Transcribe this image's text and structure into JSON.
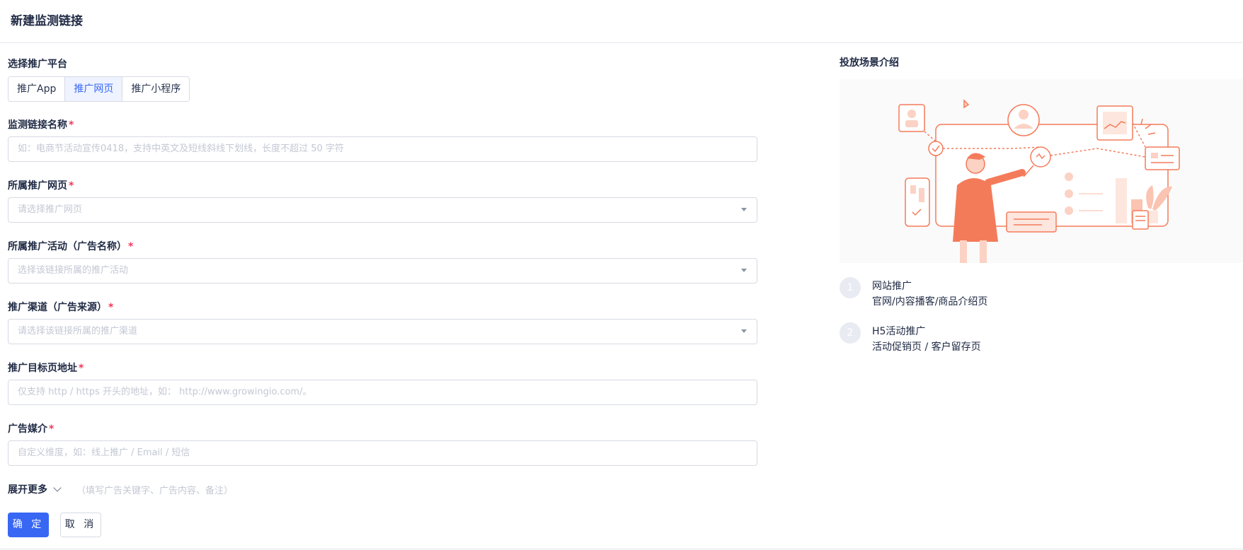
{
  "header": {
    "title": "新建监测链接"
  },
  "platform": {
    "label": "选择推广平台",
    "options": [
      "推广App",
      "推广网页",
      "推广小程序"
    ],
    "selected": "推广网页"
  },
  "fields": {
    "name": {
      "label": "监测链接名称",
      "required": "*",
      "placeholder": "如：电商节活动宣传0418，支持中英文及短线斜线下划线，长度不超过 50 字符"
    },
    "page": {
      "label": "所属推广网页",
      "required": "*",
      "placeholder": "请选择推广网页"
    },
    "activity": {
      "label": "所属推广活动（广告名称）",
      "required": "*",
      "placeholder": "选择该链接所属的推广活动"
    },
    "channel": {
      "label": "推广渠道（广告来源）",
      "required": "*",
      "placeholder": "请选择该链接所属的推广渠道"
    },
    "target": {
      "label": "推广目标页地址",
      "required": "*",
      "placeholder": "仅支持 http / https 开头的地址，如： http://www.growingio.com/。"
    },
    "media": {
      "label": "广告媒介",
      "required": "*",
      "placeholder": "自定义维度，如：线上推广 / Email / 短信"
    }
  },
  "more": {
    "label": "展开更多",
    "hint": "（填写广告关键字、广告内容、备注）"
  },
  "actions": {
    "confirm": "确 定",
    "cancel": "取 消"
  },
  "intro": {
    "title": "投放场景介绍",
    "steps": [
      {
        "num": "1",
        "title": "网站推广",
        "desc": "官网/内容播客/商品介绍页"
      },
      {
        "num": "2",
        "title": "H5活动推广",
        "desc": "活动促销页 / 客户留存页"
      }
    ]
  },
  "colors": {
    "primary": "#3867f4",
    "required": "#f0385a",
    "illustration": "#f47b5a"
  }
}
